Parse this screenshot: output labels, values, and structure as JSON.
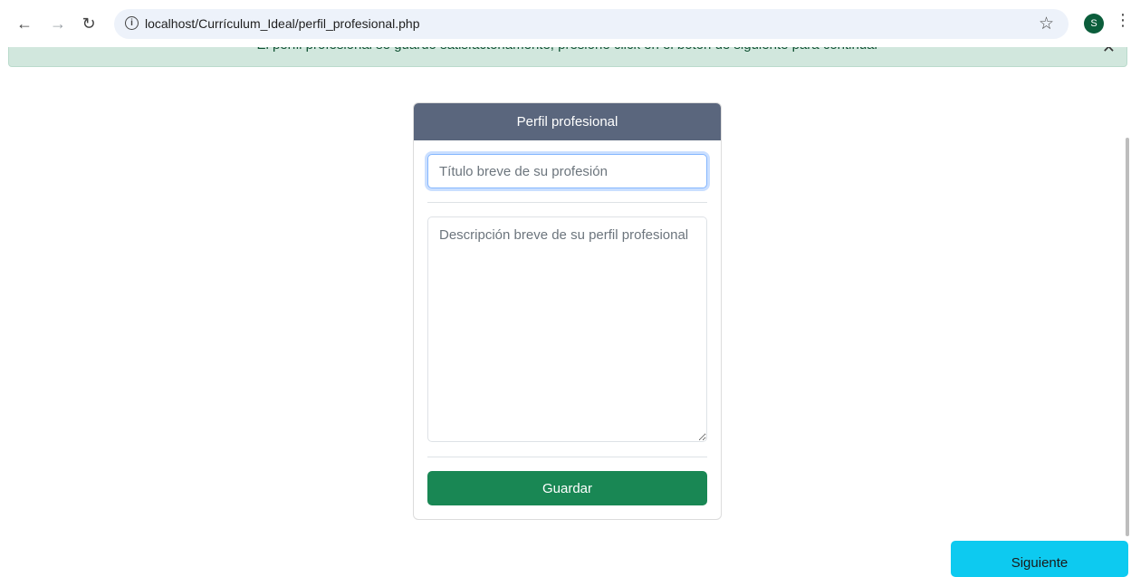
{
  "browser": {
    "back_icon": "arrow-left-icon",
    "forward_icon": "arrow-right-icon",
    "reload_icon": "reload-icon",
    "url": "localhost/Currículum_Ideal/perfil_profesional.php",
    "avatar_letter": "S"
  },
  "alert": {
    "message": "El perfil profesional se guardó satisfactoriamente, presione click en el botón de siguiente para continuar",
    "color": "#d1e7dd"
  },
  "card": {
    "header": "Perfil profesional",
    "header_color": "#5a667d",
    "title_placeholder": "Título breve de su profesión",
    "description_placeholder": "Descripción breve de su perfil profesional",
    "save_label": "Guardar",
    "save_color": "#198754"
  },
  "next_button": {
    "label": "Siguiente",
    "color": "#0dcaf0"
  }
}
